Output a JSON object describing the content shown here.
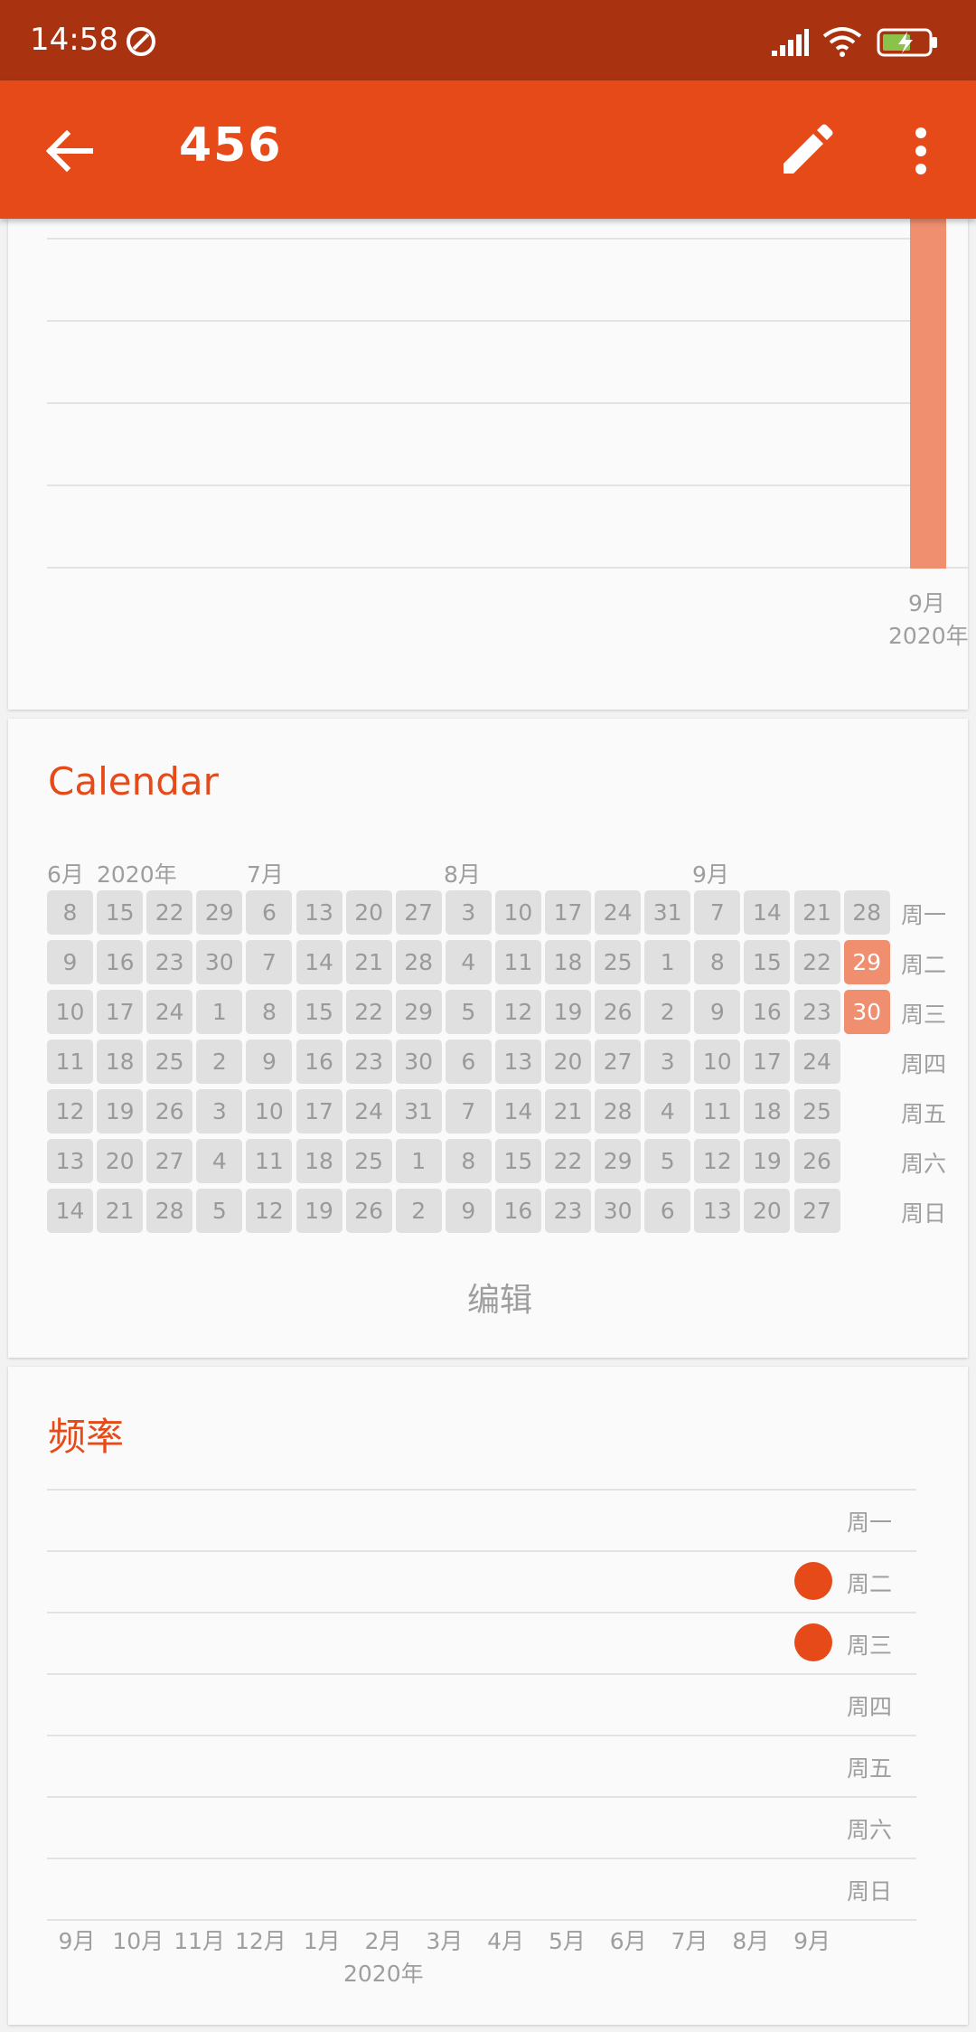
{
  "status_bar": {
    "time": "14:58",
    "icons": [
      "sync-icon",
      "signal-icon",
      "wifi-icon",
      "battery-charging-icon"
    ]
  },
  "app_bar": {
    "title": "456",
    "back_icon": "arrow-left-icon",
    "edit_icon": "pencil-icon",
    "menu_icon": "more-vert-icon"
  },
  "accent_color": "#e64a19",
  "top_chart": {
    "bar_color": "#ef8f6f",
    "x_label_month": "9月",
    "x_label_year": "2020年"
  },
  "calendar": {
    "title": "Calendar",
    "month_labels": [
      "6月",
      "2020年",
      "7月",
      "8月",
      "9月"
    ],
    "weekdays": [
      "周一",
      "周二",
      "周三",
      "周四",
      "周五",
      "周六",
      "周日"
    ],
    "columns": [
      [
        "8",
        "9",
        "10",
        "11",
        "12",
        "13",
        "14"
      ],
      [
        "15",
        "16",
        "17",
        "18",
        "19",
        "20",
        "21"
      ],
      [
        "22",
        "23",
        "24",
        "25",
        "26",
        "27",
        "28"
      ],
      [
        "29",
        "30",
        "1",
        "2",
        "3",
        "4",
        "5"
      ],
      [
        "6",
        "7",
        "8",
        "9",
        "10",
        "11",
        "12"
      ],
      [
        "13",
        "14",
        "15",
        "16",
        "17",
        "18",
        "19"
      ],
      [
        "20",
        "21",
        "22",
        "23",
        "24",
        "25",
        "26"
      ],
      [
        "27",
        "28",
        "29",
        "30",
        "31",
        "1",
        "2"
      ],
      [
        "3",
        "4",
        "5",
        "6",
        "7",
        "8",
        "9"
      ],
      [
        "10",
        "11",
        "12",
        "13",
        "14",
        "15",
        "16"
      ],
      [
        "17",
        "18",
        "19",
        "20",
        "21",
        "22",
        "23"
      ],
      [
        "24",
        "25",
        "26",
        "27",
        "28",
        "29",
        "30"
      ],
      [
        "31",
        "1",
        "2",
        "3",
        "4",
        "5",
        "6"
      ],
      [
        "7",
        "8",
        "9",
        "10",
        "11",
        "12",
        "13"
      ],
      [
        "14",
        "15",
        "16",
        "17",
        "18",
        "19",
        "20"
      ],
      [
        "21",
        "22",
        "23",
        "24",
        "25",
        "26",
        "27"
      ],
      [
        "28",
        "29",
        "30"
      ]
    ],
    "checked_days": [
      "29",
      "30"
    ],
    "edit_label": "编辑"
  },
  "frequency": {
    "title": "频率",
    "weekdays": [
      "周一",
      "周二",
      "周三",
      "周四",
      "周五",
      "周六",
      "周日"
    ],
    "dots": [
      0,
      1,
      1,
      0,
      0,
      0,
      0
    ],
    "months": [
      "9月",
      "10月",
      "11月",
      "12月",
      "1月",
      "2月",
      "3月",
      "4月",
      "5月",
      "6月",
      "7月",
      "8月",
      "9月"
    ],
    "year_label": "2020年"
  }
}
